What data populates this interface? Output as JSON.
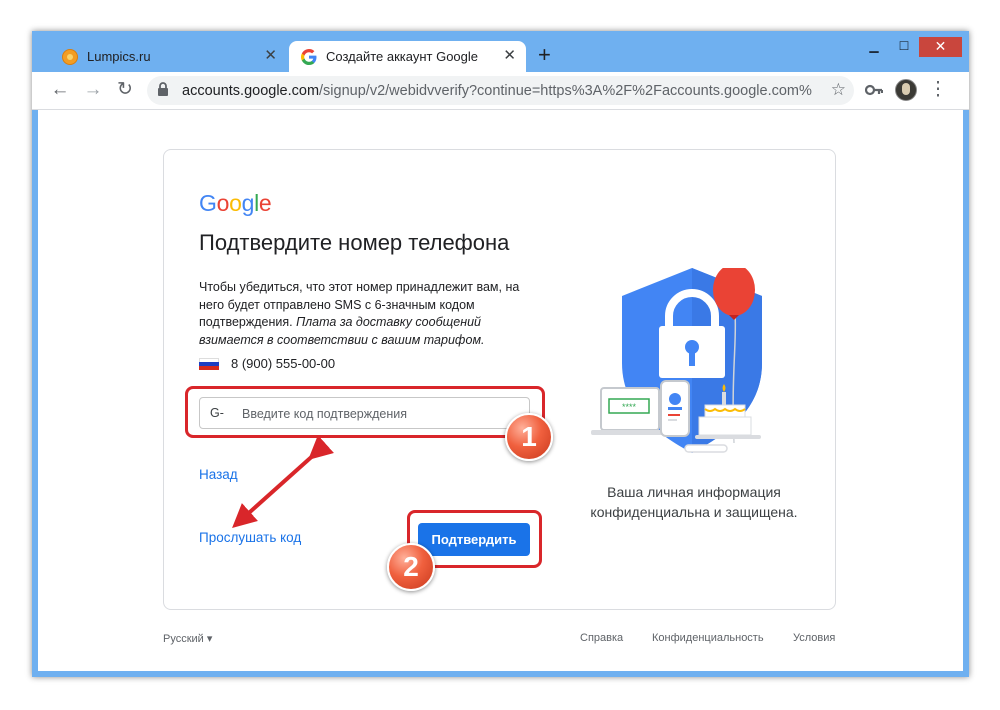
{
  "browser": {
    "tabs": [
      {
        "title": "Lumpics.ru",
        "close": "✕"
      },
      {
        "title": "Создайте аккаунт Google",
        "close": "✕"
      }
    ],
    "new_tab": "+",
    "controls": {
      "minimize": "▁",
      "maximize": "☐",
      "close": "✕"
    },
    "nav": {
      "back": "←",
      "forward": "→",
      "reload": "↻",
      "menu": "⋮"
    },
    "url_host": "accounts.google.com",
    "url_path": "/signup/v2/webidvverify?continue=https%3A%2F%2Faccounts.google.com%2F...",
    "star": "☆"
  },
  "card": {
    "logo_letters": [
      "G",
      "o",
      "o",
      "g",
      "l",
      "e"
    ],
    "heading": "Подтвердите номер телефона",
    "description_normal": "Чтобы убедиться, что этот номер принадлежит вам, на него будет отправлено SMS с 6-значным кодом подтверждения. ",
    "description_italic": "Плата за доставку сообщений взимается в соответствии с вашим тарифом.",
    "phone": "8 (900) 555-00-00",
    "code_prefix": "G-",
    "code_placeholder": "Введите код подтверждения",
    "back_link": "Назад",
    "listen_link": "Прослушать код",
    "verify_button": "Подтвердить",
    "illustration_password": "****",
    "caption": "Ваша личная информация конфиденциальна и защищена."
  },
  "footer": {
    "language": "Русский",
    "links": [
      "Справка",
      "Конфиденциальность",
      "Условия"
    ]
  },
  "annotations": {
    "badge_1": "1",
    "badge_2": "2"
  },
  "colors": {
    "window_frame": "#6fb0f0",
    "google_blue": "#4285f4",
    "google_red": "#ea4335",
    "google_yellow": "#fbbc05",
    "google_green": "#34a853",
    "link": "#1a73e8",
    "callout_red": "#d9262a",
    "badge_orange": "#f0603e"
  },
  "icons": {
    "lumpics_favicon": "orange-circle",
    "google_favicon": "google-g",
    "lock": "lock-icon",
    "key": "key-icon",
    "flag": "russian-flag"
  }
}
